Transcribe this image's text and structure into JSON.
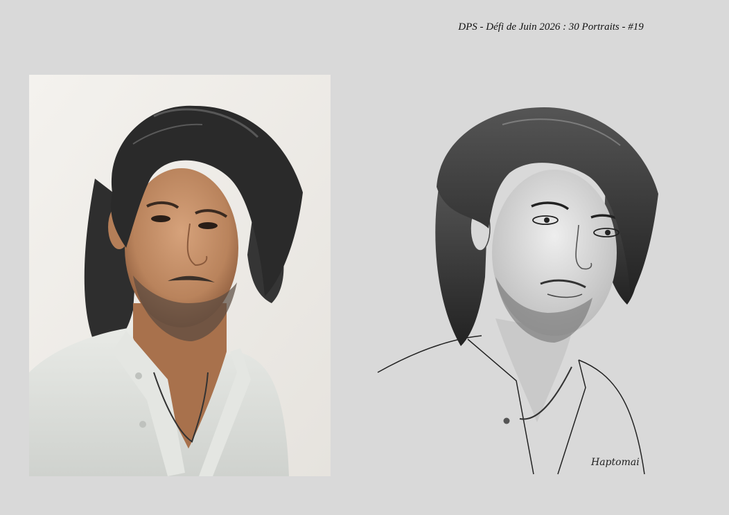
{
  "caption": {
    "text": "DPS - Défi de Juin 2026 : 30 Portraits - #19"
  },
  "photo": {
    "icon": "portrait-photo-image"
  },
  "sketch": {
    "icon": "portrait-sketch-image",
    "signature": "Haptomai"
  },
  "colors": {
    "background": "#d9d9d9",
    "photo_wall": "#f0eeea",
    "hair": "#2a2a2a",
    "skin": "#c89872",
    "shirt": "#dfe1dd"
  }
}
